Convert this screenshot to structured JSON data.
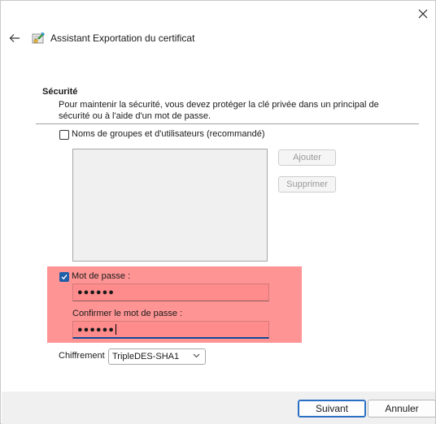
{
  "window": {
    "title": "Assistant Exportation du certificat"
  },
  "section": {
    "heading": "Sécurité",
    "description": "Pour maintenir la sécurité, vous devez protéger la clé privée dans un principal de sécurité ou à l'aide d'un mot de passe."
  },
  "groups": {
    "checkbox_label": "Noms de groupes et d'utilisateurs (recommandé)",
    "checked": false,
    "add_label": "Ajouter",
    "remove_label": "Supprimer"
  },
  "password": {
    "checkbox_label": "Mot de passe :",
    "checked": true,
    "value": "●●●●●●",
    "confirm_label": "Confirmer le mot de passe :",
    "confirm_value": "●●●●●●"
  },
  "encryption": {
    "label": "Chiffrement",
    "selected": "TripleDES-SHA1"
  },
  "footer": {
    "next_label": "Suivant",
    "cancel_label": "Annuler"
  },
  "icons": {
    "close": "close-icon",
    "back": "back-arrow-icon",
    "wizard": "certificate-wizard-icon",
    "dropdown": "chevron-down-icon"
  },
  "colors": {
    "highlight": "#fe9594",
    "accent": "#2a6fc4",
    "checkbox_checked": "#1f5ea8"
  }
}
